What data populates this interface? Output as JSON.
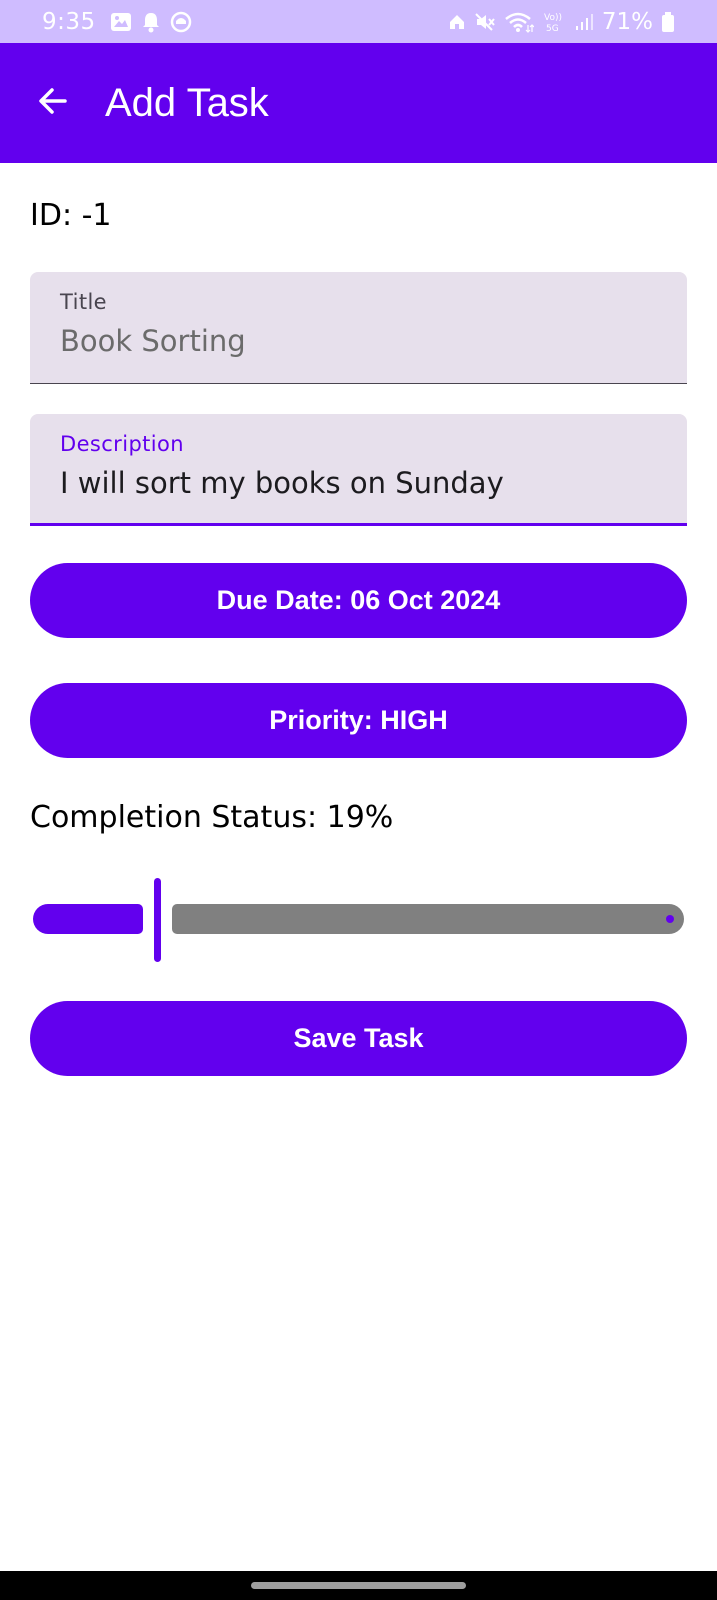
{
  "status_bar": {
    "time": "9:35",
    "battery": "71%",
    "left_icons": [
      "image-icon",
      "bell-icon",
      "app-circle-icon"
    ],
    "right_icons": [
      "home-icon",
      "mute-icon",
      "wifi-icon",
      "volte-5g-icon",
      "signal-icon",
      "battery-icon"
    ]
  },
  "app_bar": {
    "title": "Add Task",
    "back_icon": "arrow-back-icon"
  },
  "task": {
    "id_label": "ID: -1",
    "title_field": {
      "label": "Title",
      "value": "Book Sorting"
    },
    "description_field": {
      "label": "Description",
      "value": "I will sort my books on Sunday"
    },
    "due_date_button": "Due Date: 06 Oct 2024",
    "priority_button": "Priority: HIGH",
    "completion_label": "Completion Status: 19%",
    "completion_value": 0.19,
    "save_button": "Save Task"
  },
  "colors": {
    "primary": "#6200ee",
    "status_bar": "#cfbcff",
    "field_background": "#e7e0ec",
    "slider_inactive": "#808080"
  }
}
